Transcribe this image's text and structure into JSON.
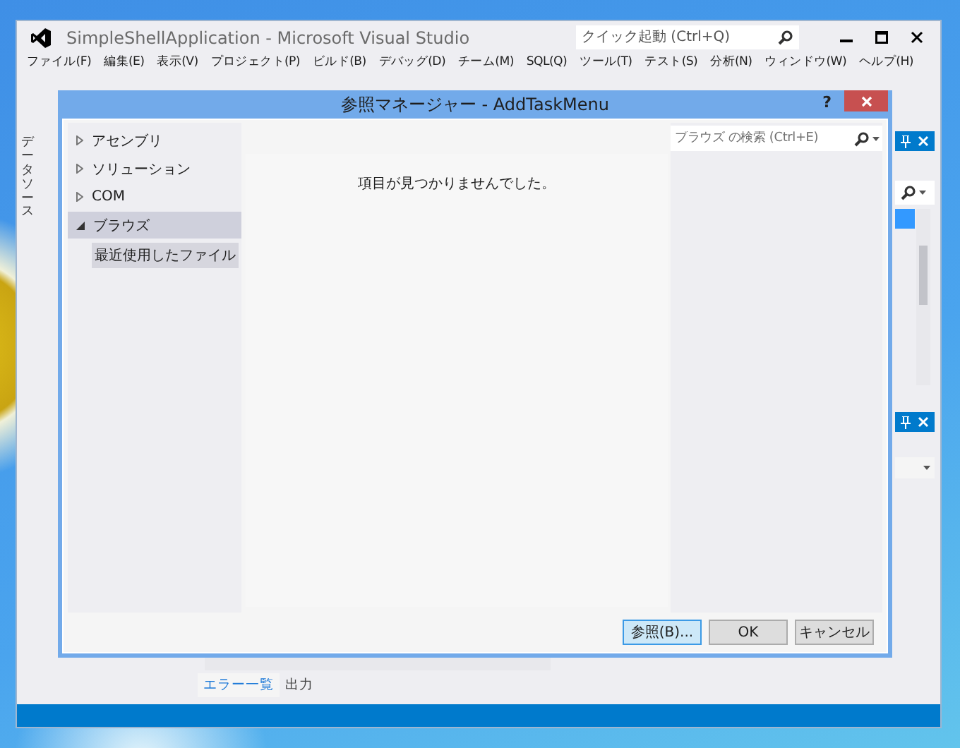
{
  "ide": {
    "title": "SimpleShellApplication - Microsoft Visual Studio",
    "quick_launch": {
      "placeholder": "クイック起動 (Ctrl+Q)"
    },
    "menu": [
      "ファイル(F)",
      "編集(E)",
      "表示(V)",
      "プロジェクト(P)",
      "ビルド(B)",
      "デバッグ(D)",
      "チーム(M)",
      "SQL(Q)",
      "ツール(T)",
      "テスト(S)",
      "分析(N)",
      "ウィンドウ(W)",
      "ヘルプ(H)"
    ],
    "side_tab": "データソース",
    "bottom_tabs": [
      {
        "label": "エラー一覧",
        "selected": true
      },
      {
        "label": "出力",
        "selected": false
      }
    ]
  },
  "dialog": {
    "title": "参照マネージャー - AddTaskMenu",
    "help": "?",
    "search": {
      "placeholder": "ブラウズ の検索 (Ctrl+E)"
    },
    "categories": [
      {
        "label": "アセンブリ",
        "expanded": false,
        "selected": false
      },
      {
        "label": "ソリューション",
        "expanded": false,
        "selected": false
      },
      {
        "label": "COM",
        "expanded": false,
        "selected": false
      },
      {
        "label": "ブラウズ",
        "expanded": true,
        "selected": true,
        "children": [
          {
            "label": "最近使用したファイル",
            "selected": true
          }
        ]
      }
    ],
    "empty_message": "項目が見つかりませんでした。",
    "buttons": [
      {
        "label": "参照(B)...",
        "focused": true
      },
      {
        "label": "OK",
        "focused": false
      },
      {
        "label": "キャンセル",
        "focused": false
      }
    ]
  }
}
